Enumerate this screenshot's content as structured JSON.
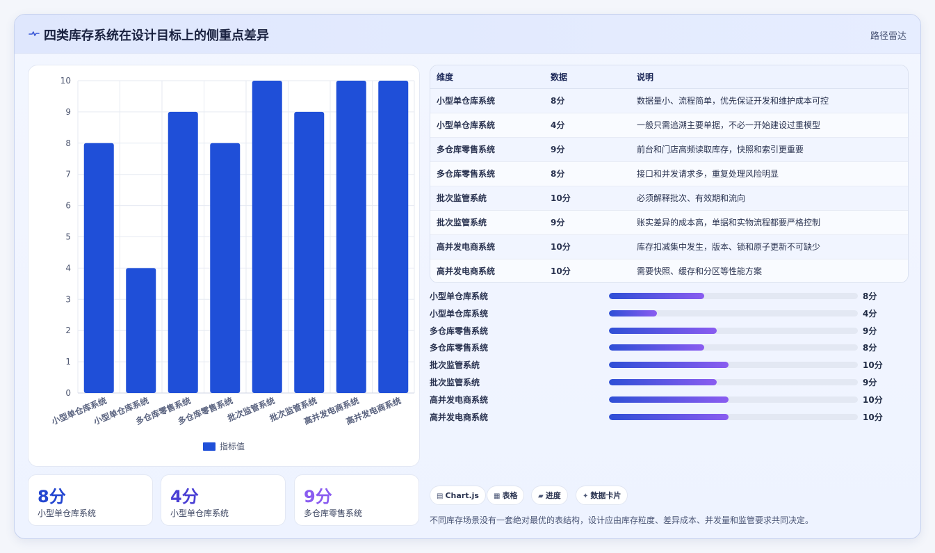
{
  "header": {
    "title": "四类库存系统在设计目标上的侧重点差异",
    "route_label": "路径雷达",
    "icon": "pulse-icon"
  },
  "chart_data": {
    "type": "bar",
    "categories": [
      "小型单仓库系统",
      "小型单仓库系统",
      "多仓库零售系统",
      "多仓库零售系统",
      "批次监管系统",
      "批次监管系统",
      "高并发电商系统",
      "高并发电商系统"
    ],
    "series": [
      {
        "name": "指标值",
        "values": [
          8,
          4,
          9,
          8,
          10,
          9,
          10,
          10
        ],
        "color": "#1f4fd8"
      }
    ],
    "ylim": [
      0,
      10
    ],
    "yticks": [
      0,
      1,
      2,
      3,
      4,
      5,
      6,
      7,
      8,
      9,
      10
    ],
    "grid": true,
    "legend_position": "bottom"
  },
  "kpis": [
    {
      "value": "8分",
      "label": "小型单仓库系统",
      "color": "#2346d0"
    },
    {
      "value": "4分",
      "label": "小型单仓库系统",
      "color": "#4a3fd4"
    },
    {
      "value": "9分",
      "label": "多仓库零售系统",
      "color": "#8a5cf0"
    }
  ],
  "table": {
    "headers": [
      "维度",
      "数据",
      "说明"
    ],
    "rows": [
      [
        "小型单仓库系统",
        "8分",
        "数据量小、流程简单，优先保证开发和维护成本可控"
      ],
      [
        "小型单仓库系统",
        "4分",
        "一般只需追溯主要单据，不必一开始建设过重模型"
      ],
      [
        "多仓库零售系统",
        "9分",
        "前台和门店高频读取库存，快照和索引更重要"
      ],
      [
        "多仓库零售系统",
        "8分",
        "接口和并发请求多，重复处理风险明显"
      ],
      [
        "批次监管系统",
        "10分",
        "必须解释批次、有效期和流向"
      ],
      [
        "批次监管系统",
        "9分",
        "账实差异的成本高，单据和实物流程都要严格控制"
      ],
      [
        "高并发电商系统",
        "10分",
        "库存扣减集中发生，版本、锁和原子更新不可缺少"
      ],
      [
        "高并发电商系统",
        "10分",
        "需要快照、缓存和分区等性能方案"
      ]
    ]
  },
  "progress": {
    "max": 10,
    "items": [
      {
        "label": "小型单仓库系统",
        "value": 8,
        "display": "8分"
      },
      {
        "label": "小型单仓库系统",
        "value": 4,
        "display": "4分"
      },
      {
        "label": "多仓库零售系统",
        "value": 9,
        "display": "9分"
      },
      {
        "label": "多仓库零售系统",
        "value": 8,
        "display": "8分"
      },
      {
        "label": "批次监管系统",
        "value": 10,
        "display": "10分"
      },
      {
        "label": "批次监管系统",
        "value": 9,
        "display": "9分"
      },
      {
        "label": "高并发电商系统",
        "value": 10,
        "display": "10分"
      },
      {
        "label": "高并发电商系统",
        "value": 10,
        "display": "10分"
      }
    ]
  },
  "chips": [
    {
      "icon": "chart-icon",
      "glyph": "▤",
      "label": "Chart.js"
    },
    {
      "icon": "table-icon",
      "glyph": "▦",
      "label": "表格"
    },
    {
      "icon": "progress-icon",
      "glyph": "▰",
      "label": "进度"
    },
    {
      "icon": "card-icon",
      "glyph": "✦",
      "label": "数据卡片"
    }
  ],
  "footnote": "不同库存场景没有一套绝对最优的表结构，设计应由库存粒度、差异成本、并发量和监管要求共同决定。"
}
